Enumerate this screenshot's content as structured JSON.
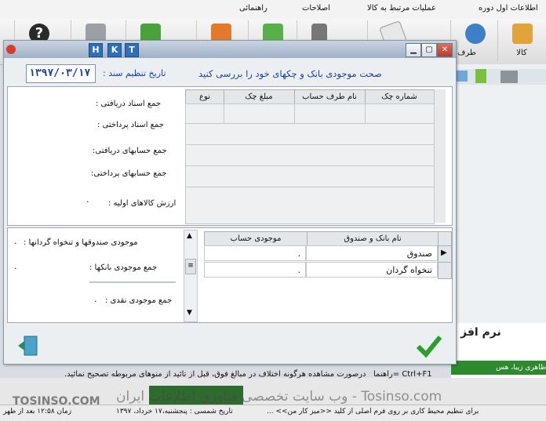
{
  "background": {
    "menu": [
      "اطلاعات اول دوره",
      "عملیات مرتبط به کالا",
      "اصلاحات",
      "راهنمائی"
    ],
    "toolbar": [
      {
        "label": "کالا",
        "icon": "box-icon"
      },
      {
        "label": "طرف",
        "icon": "person-icon"
      },
      {
        "label": "",
        "icon": "paper-icon"
      },
      {
        "label": "",
        "icon": "calculator-icon"
      },
      {
        "label": "",
        "icon": "arrow-doc-icon"
      },
      {
        "label": "",
        "icon": "folder-icon"
      },
      {
        "label": "",
        "icon": "box-green-icon"
      },
      {
        "label": "",
        "icon": "tools-icon"
      },
      {
        "label": "",
        "icon": "help-icon"
      }
    ],
    "brand": "نرم افز",
    "brand_sub": "ظاهری زیبا، هس",
    "watermark_left": "TOSINSO.COM",
    "watermark_center": "Tosinso.com - وب سایت تخصصی فناوری اطلاعات ایران",
    "status_left": "زمان ۱۲:۵۸ بعد از ظهر",
    "status_mid": "تاریخ شمسی : پنجشنبه،۱۷ خرداد، ۱۳۹۷",
    "status_right": "برای تنظیم محیط کاری بر روی فرم اصلی از کلید <<میز کار من>> ..."
  },
  "dialog": {
    "hkt": [
      "H",
      "K",
      "T"
    ],
    "title": "صحت موجودی بانک و چکهای خود را بررسی کنید",
    "date_label": "تاریخ تنظیم سند :",
    "date_value": "۱۳۹۷/۰۳/۱۷",
    "top_labels": [
      "جمع اسناد دریافتی :",
      "جمع اسناد پرداختی :",
      "جمع حسابهای دریافتی:",
      "جمع حسابهای پرداختی:",
      "ارزش کالاهای اولیه :"
    ],
    "check_columns": [
      "شماره چک",
      "نام طرف حساب",
      "مبلغ چک",
      "نوع"
    ],
    "bottom_labels": [
      "موجودی صندوقها و تنخواه گردانها :",
      "جمع موجودی بانکها :",
      "جمع موجودی نقدی :"
    ],
    "bottom_values": [
      ".",
      ".",
      "."
    ],
    "top_value": ".",
    "bank_columns": [
      "نام بانک و صندوق",
      "موجودی حساب"
    ],
    "bank_rows": [
      {
        "name": "صندوق",
        "balance": "."
      },
      {
        "name": "تنخواه گردان",
        "balance": "."
      }
    ],
    "footer_hint": "راهنما= Ctrl+F1",
    "footer_text": "درصورت مشاهده هرگونه اختلاف در مبالغ فوق، قبل از تائید از منوهای مربوطه تصحیح نمائید.",
    "colors": {
      "accent": "#1a3f9c",
      "check": "#2aa02a",
      "title_bar": "#b4c3d4"
    }
  }
}
